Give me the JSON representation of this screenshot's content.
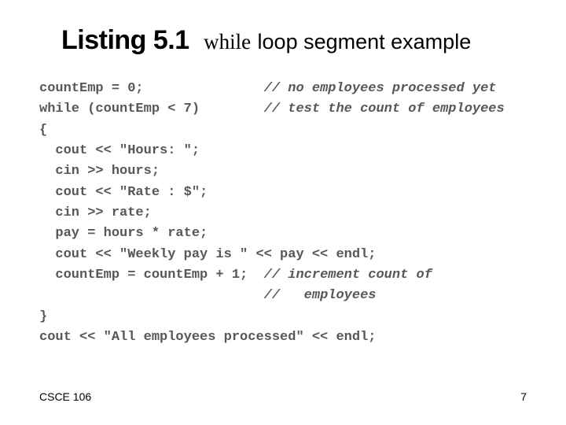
{
  "title": {
    "listing": "Listing 5.1",
    "while_kw": "while",
    "rest": "loop segment example"
  },
  "code": {
    "l1": "countEmp = 0;               ",
    "c1": "// no employees processed yet",
    "l2": "while (countEmp < 7)        ",
    "c2": "// test the count of employees",
    "l3": "{",
    "l4": "  cout << \"Hours: \";",
    "l5": "  cin >> hours;",
    "l6": "  cout << \"Rate : $\";",
    "l7": "  cin >> rate;",
    "l8": "  pay = hours * rate;",
    "l9": "  cout << \"Weekly pay is \" << pay << endl;",
    "l10": "  countEmp = countEmp + 1;  ",
    "c10": "// increment count of",
    "l11": "                            ",
    "c11": "//   employees",
    "l12": "}",
    "l13": "cout << \"All employees processed\" << endl;"
  },
  "footer": {
    "course": "CSCE 106",
    "page": "7"
  }
}
